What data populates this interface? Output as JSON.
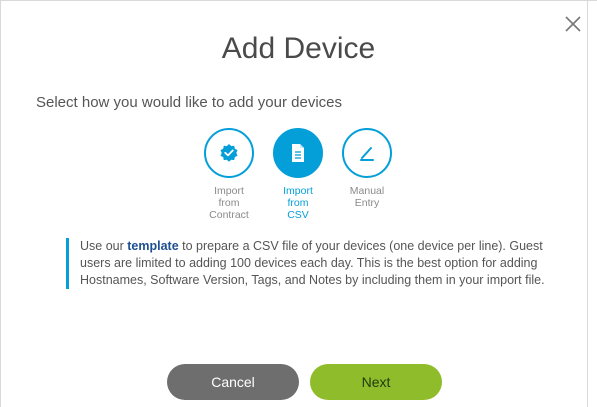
{
  "dialog": {
    "title": "Add Device",
    "subtitle": "Select how you would like to add your devices"
  },
  "options": [
    {
      "line1": "Import",
      "line2": "from",
      "line3": "Contract",
      "icon": "verified-badge-icon",
      "selected": false
    },
    {
      "line1": "Import",
      "line2": "from",
      "line3": "CSV",
      "icon": "document-icon",
      "selected": true
    },
    {
      "line1": "Manual",
      "line2": "Entry",
      "line3": "",
      "icon": "pencil-icon",
      "selected": false
    }
  ],
  "info": {
    "prefix": "Use our ",
    "link": "template",
    "suffix": " to prepare a CSV file of your devices (one device per line). Guest users are limited to adding 100 devices each day. This is the best option for adding Hostnames, Software Version, Tags, and Notes by including them in your import file."
  },
  "buttons": {
    "cancel": "Cancel",
    "next": "Next"
  },
  "colors": {
    "accent": "#049fd9",
    "next_button": "#8fbc2a",
    "cancel_button": "#6e6e6e"
  }
}
